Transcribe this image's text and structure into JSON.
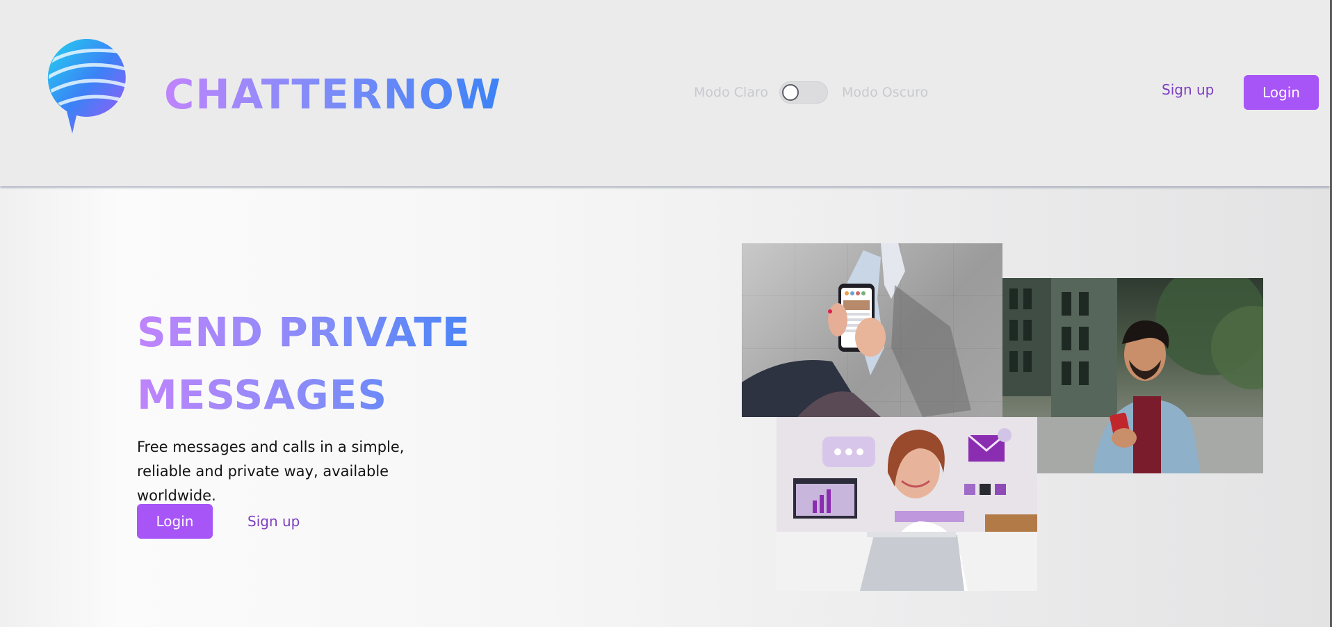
{
  "header": {
    "brand_name": "CHATTERNOW",
    "logo_icon": "chat-bubble-globe-icon",
    "theme_toggle": {
      "light_label": "Modo Claro",
      "dark_label": "Modo Oscuro",
      "state": "off"
    },
    "nav": {
      "signup_label": "Sign up",
      "login_label": "Login"
    }
  },
  "hero": {
    "title_line_1": "SEND PRIVATE",
    "title_line_2": "MESSAGES",
    "description": "Free messages and calls in a simple, reliable and private way, available worldwide.",
    "login_label": "Login",
    "signup_label": "Sign up"
  },
  "photos": [
    {
      "name": "phone-in-hand-photo"
    },
    {
      "name": "smiling-man-with-phone-photo"
    },
    {
      "name": "woman-with-laptop-photo"
    }
  ],
  "colors": {
    "accent": "#a855f7",
    "link": "#7e3fc0",
    "gradient_start": "#c084fc",
    "gradient_end": "#3b82f6",
    "header_bg": "#ebebec"
  }
}
